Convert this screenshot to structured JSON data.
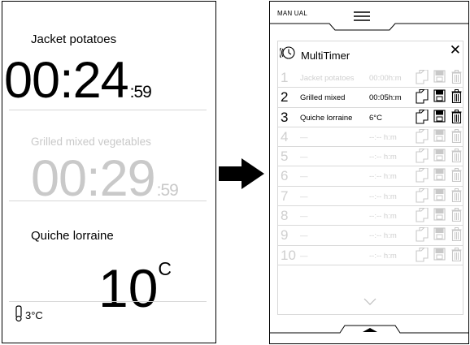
{
  "left": {
    "timer1": {
      "label": "Jacket potatoes",
      "time": "00:24",
      "seconds": ":59"
    },
    "timer2": {
      "label": "Grilled mixed vegetables",
      "time": "00:29",
      "seconds": ":59"
    },
    "timer3": {
      "label": "Quiche lorraine",
      "temp": "10",
      "unit": "C"
    },
    "probe": {
      "icon": "probe-thermometer-icon",
      "reading": "3°C"
    }
  },
  "right": {
    "mode_label": "MAN UAL",
    "menu_icon": "hamburger-menu-icon",
    "panel": {
      "icon": "multitimer-icon",
      "title": "MultiTimer",
      "close": "✕"
    },
    "rows": [
      {
        "num": "1",
        "name": "Jacket potatoes",
        "value": "00:00h:m",
        "state": "inactive"
      },
      {
        "num": "2",
        "name": "Grilled mixed",
        "value": "00:05h:m",
        "state": "active"
      },
      {
        "num": "3",
        "name": "Quiche lorraine",
        "value": "6°C",
        "state": "active"
      },
      {
        "num": "4",
        "name": "—",
        "value": "--:-- h:m",
        "state": "inactive"
      },
      {
        "num": "5",
        "name": "—",
        "value": "--:-- h:m",
        "state": "inactive"
      },
      {
        "num": "6",
        "name": "—",
        "value": "--:-- h:m",
        "state": "inactive"
      },
      {
        "num": "7",
        "name": "—",
        "value": "--:-- h:m",
        "state": "inactive"
      },
      {
        "num": "8",
        "name": "—",
        "value": "--:-- h:m",
        "state": "inactive"
      },
      {
        "num": "9",
        "name": "—",
        "value": "--:-- h:m",
        "state": "inactive"
      },
      {
        "num": "10",
        "name": "—",
        "value": "--:-- h:m",
        "state": "inactive"
      }
    ],
    "scroll_icon": "chevron-down-icon",
    "bottom_icon": "chevron-up-icon"
  },
  "colors": {
    "active": "#000000",
    "inactive": "#c9c9c9",
    "divider": "#d9d9d9"
  }
}
